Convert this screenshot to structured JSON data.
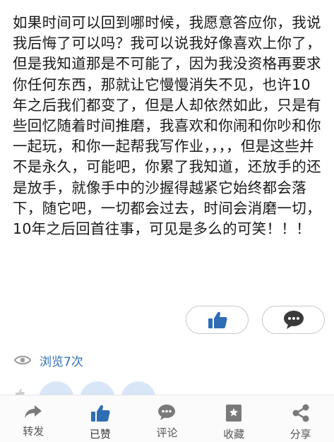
{
  "post": {
    "text": "如果时间可以回到哪时候，我愿意答应你，我说我后悔了可以吗？我可以说我好像喜欢上你了，但是我知道那是不可能了，因为我没资格再要求你任何东西，那就让它慢慢消失不见，也许10年之后我们都变了，但是人却依然如此，只是有些回忆随着时间推磨，我喜欢和你闹和你吵和你一起玩，和你一起帮我写作业，，，，但是这些并不是永久，可能吧，你累了我知道，还放手的还是放手，就像手中的沙握得越紧它始终都会落下，随它吧，一切都会过去，时间会消磨一切，10年之后回首往事，可见是多么的可笑！！！"
  },
  "actions": {
    "like_icon": "thumbs-up-icon",
    "comment_icon": "chat-bubble-icon"
  },
  "stats": {
    "views_label": "浏览7次"
  },
  "bottom_bar": {
    "items": [
      {
        "label": "转发",
        "icon": "share-arrow-icon"
      },
      {
        "label": "已赞",
        "icon": "thumbs-up-icon"
      },
      {
        "label": "评论",
        "icon": "comment-icon"
      },
      {
        "label": "收藏",
        "icon": "bookmark-icon"
      },
      {
        "label": "分享",
        "icon": "share-nodes-icon"
      }
    ]
  },
  "colors": {
    "accent": "#2f6db5",
    "icon_gray": "#8a8a8a",
    "dark_icon": "#3a3a3a"
  }
}
